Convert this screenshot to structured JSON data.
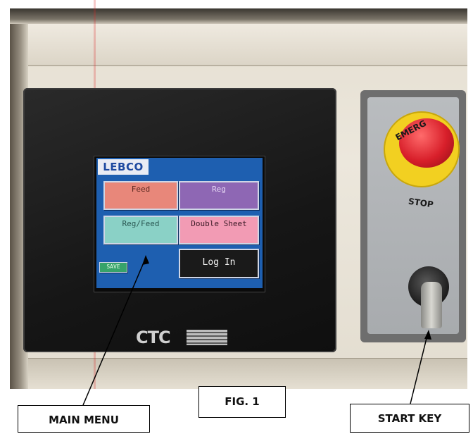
{
  "hmi": {
    "logo_text": "LEBCO",
    "buttons": {
      "feed": "Feed",
      "reg": "Reg",
      "reg_feed": "Reg/Feed",
      "double_sheet": "Double Sheet",
      "log_in": "Log In",
      "save": "SAVE"
    },
    "brand": "CTC"
  },
  "estop": {
    "top_text": "EMERG",
    "bottom_text": "STOP"
  },
  "callouts": {
    "main_menu": "MAIN MENU",
    "figure": "FIG. 1",
    "start_key": "START KEY"
  },
  "colors": {
    "screen_bg": "#1e5fb0",
    "estop_red": "#d81f2a",
    "estop_yellow": "#f2d021"
  }
}
